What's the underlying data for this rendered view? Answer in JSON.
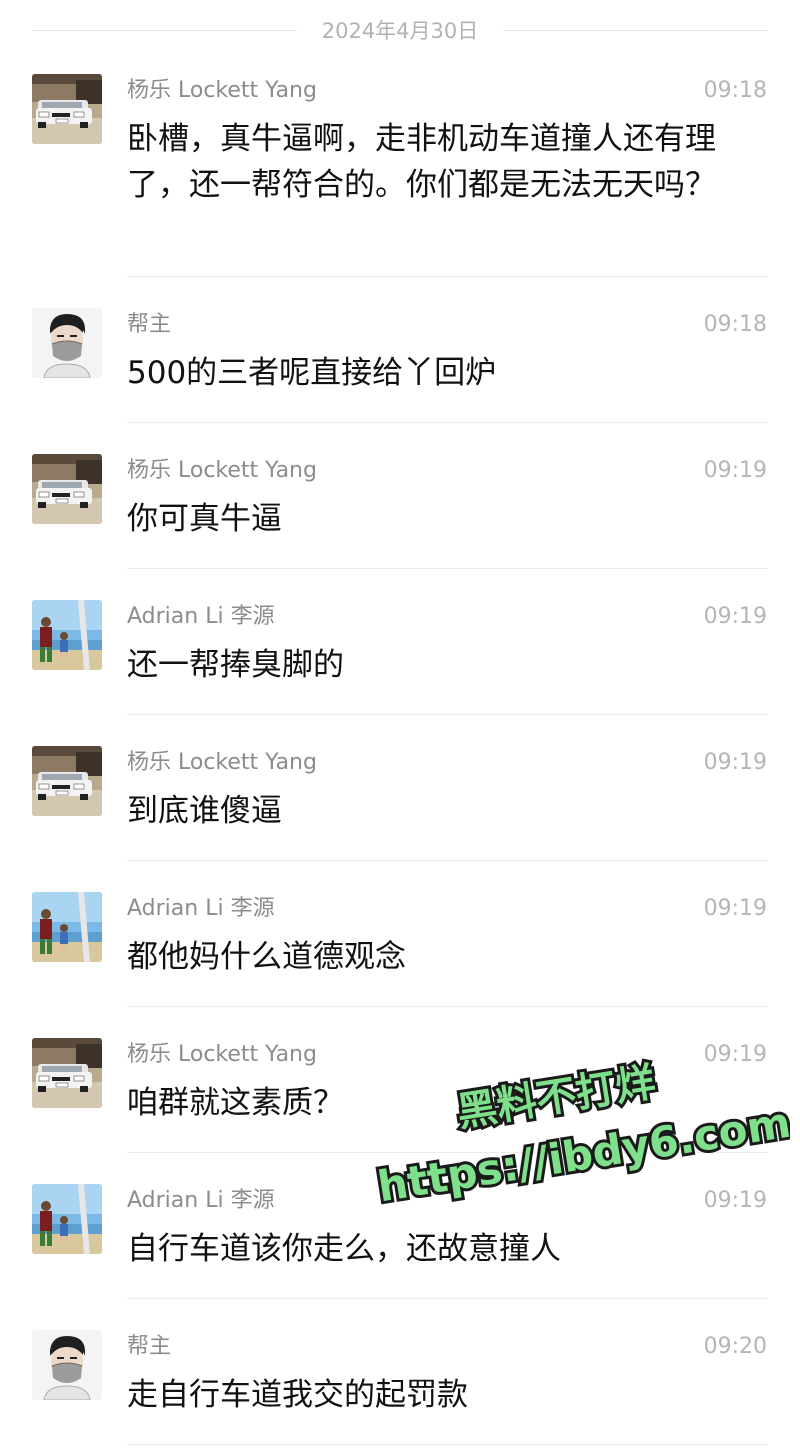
{
  "date_divider": "2024年4月30日",
  "messages": [
    {
      "sender": "杨乐 Lockett Yang",
      "avatar": "car-avatar",
      "time": "09:18",
      "text": "卧槽，真牛逼啊，走非机动车道撞人还有理了，还一帮符合的。你们都是无法无天吗？"
    },
    {
      "sender": "帮主",
      "avatar": "masked-man-avatar",
      "time": "09:18",
      "text": "500的三者呢直接给丫回炉"
    },
    {
      "sender": "杨乐 Lockett Yang",
      "avatar": "car-avatar",
      "time": "09:19",
      "text": "你可真牛逼"
    },
    {
      "sender": "Adrian Li 李源",
      "avatar": "beach-avatar",
      "time": "09:19",
      "text": "还一帮捧臭脚的"
    },
    {
      "sender": "杨乐 Lockett Yang",
      "avatar": "car-avatar",
      "time": "09:19",
      "text": "到底谁傻逼"
    },
    {
      "sender": "Adrian Li 李源",
      "avatar": "beach-avatar",
      "time": "09:19",
      "text": "都他妈什么道德观念"
    },
    {
      "sender": "杨乐 Lockett Yang",
      "avatar": "car-avatar",
      "time": "09:19",
      "text": "咱群就这素质？"
    },
    {
      "sender": "Adrian Li 李源",
      "avatar": "beach-avatar",
      "time": "09:19",
      "text": "自行车道该你走么，还故意撞人"
    },
    {
      "sender": "帮主",
      "avatar": "masked-man-avatar",
      "time": "09:20",
      "text": "走自行车道我交的起罚款"
    }
  ],
  "watermark": {
    "line1": "黑料不打烊",
    "line2": "https://ibdy6.com",
    "color": "#7ee08a"
  }
}
